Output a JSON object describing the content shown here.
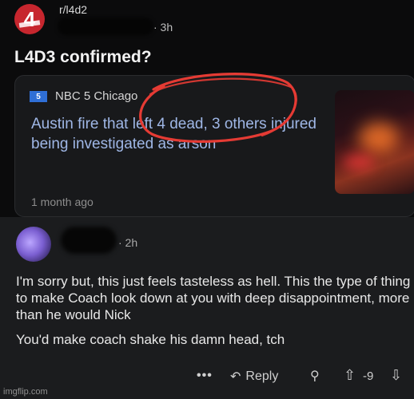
{
  "post": {
    "subreddit": "r/l4d2",
    "avatar_label": "4",
    "time": "· 3h",
    "title": "L4D3 confirmed?",
    "link_card": {
      "source_logo": "5",
      "source_name": "NBC 5 Chicago",
      "headline": "Austin fire that left 4 dead, 3 others injured being investigated as arson",
      "age": "1 month ago"
    }
  },
  "comment": {
    "time": "· 2h",
    "paragraph1": "I'm sorry but, this just feels tasteless as hell. This the type of thing to make Coach look down at you with deep disappointment, more than he would Nick",
    "paragraph2": "You'd make coach shake his damn head, tch",
    "actions": {
      "more": "•••",
      "reply": "Reply",
      "award_icon": "award-icon",
      "score": "-9"
    }
  },
  "watermark": "imgflip.com",
  "colors": {
    "annotation_circle": "#e53b34",
    "link_text": "#9fb7e6",
    "subreddit_avatar": "#c7262e"
  }
}
